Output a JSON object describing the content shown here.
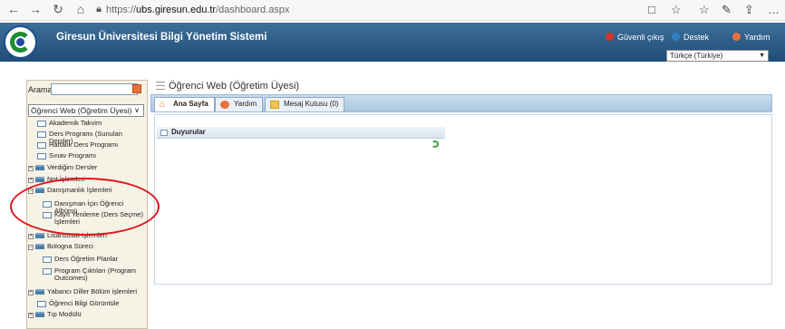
{
  "browser": {
    "url_prefix": "https://",
    "url_domain": "ubs.giresun.edu.tr",
    "url_path": "/dashboard.aspx",
    "icons": [
      "back-icon",
      "forward-icon",
      "refresh-icon",
      "home-icon",
      "lock-icon",
      "reading-view-icon",
      "favorite-icon",
      "favorites-icon",
      "notes-icon",
      "share-icon",
      "more-icon"
    ]
  },
  "header": {
    "title": "Giresun Üniversitesi Bilgi Yönetim Sistemi",
    "links": [
      {
        "label": "Güvenli çıkış",
        "color": "#d9342b"
      },
      {
        "label": "Destek",
        "color": "#2f7fc7"
      },
      {
        "label": "Yardım",
        "color": "#e8713a"
      }
    ],
    "language": "Türkçe (Türkiye)"
  },
  "sidebar": {
    "search_label": "Arama:",
    "search_value": "",
    "module": "Öğrenci Web (Öğretim Üyesi)",
    "tree": [
      {
        "label": "Akademik Takvim",
        "type": "page"
      },
      {
        "label": "Ders Programı (Sunulan Dersler)",
        "type": "page"
      },
      {
        "label": "Haftalık Ders Programı",
        "type": "page"
      },
      {
        "label": "Sınav Programı",
        "type": "page"
      },
      {
        "label": "Verdiğim Dersler",
        "type": "folder"
      },
      {
        "label": "Not İşlemleri",
        "type": "folder"
      },
      {
        "label": "Danışmanlık İşlemleri",
        "type": "folder"
      },
      {
        "label": "Danışman İçin Öğrenci Albümü",
        "type": "page"
      },
      {
        "label": "Kayıt Yenileme (Ders Seçme) İşlemleri",
        "type": "page"
      },
      {
        "label": "Lisansüstü İşlemleri",
        "type": "folder"
      },
      {
        "label": "Bologna Süreci",
        "type": "folder"
      },
      {
        "label": "Ders Öğretim Planlar",
        "type": "page"
      },
      {
        "label": "Program Çıktıları (Program Outcomes)",
        "type": "page"
      },
      {
        "label": "Yabancı Diller Bölüm işlemleri",
        "type": "folder"
      },
      {
        "label": "Öğrenci Bilgi Görüntüle",
        "type": "page"
      },
      {
        "label": "Tıp Modülü",
        "type": "folder"
      }
    ]
  },
  "main": {
    "title": "Öğrenci Web (Öğretim Üyesi)",
    "tabs": [
      "Ana Sayfa",
      "Yardım",
      "Mesaj Kutusu (0)"
    ],
    "panel_title": "Duyurular"
  }
}
